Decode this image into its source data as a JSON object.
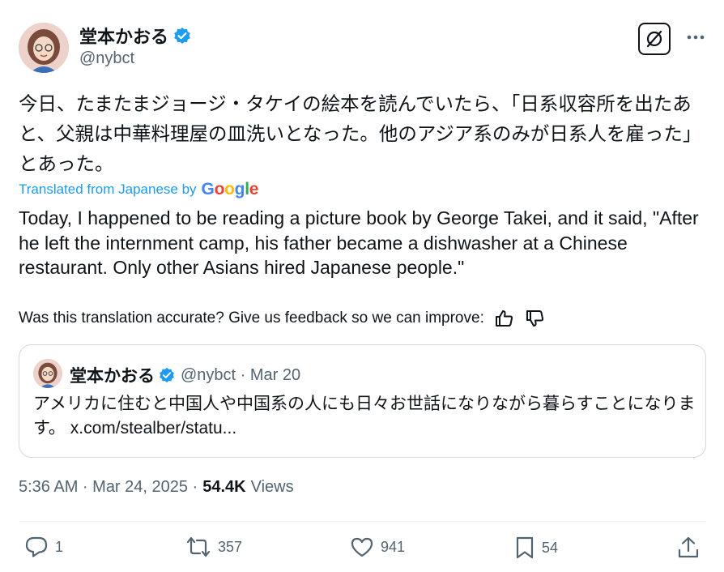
{
  "author": {
    "display_name": "堂本かおる",
    "handle": "@nybct",
    "verified_icon": "verified-badge-icon"
  },
  "tweet": {
    "text_jp": "今日、たまたまジョージ・タケイの絵本を読んでいたら、「日系収容所を出たあと、父親は中華料理屋の皿洗いとなった。他のアジア系のみが日系人を雇った」とあった。",
    "translated_label": "Translated from Japanese by",
    "translation_provider": "Google",
    "text_en": "Today, I happened to be reading a picture book by George Takei, and it said, \"After he left the internment camp, his father became a dishwasher at a Chinese restaurant. Only other Asians hired Japanese people.\"",
    "feedback_prompt": "Was this translation accurate? Give us feedback so we can improve:"
  },
  "quote": {
    "display_name": "堂本かおる",
    "handle_date": "@nybct · Mar 20",
    "text": "アメリカに住むと中国人や中国系の人にも日々お世話になりながら暮らすことになります。",
    "link": "x.com/stealber/statu..."
  },
  "meta": {
    "timestamp": "5:36 AM · Mar 24, 2025 ·",
    "views_count": "54.4K",
    "views_label": "Views"
  },
  "actions": {
    "replies": "1",
    "reposts": "357",
    "likes": "941",
    "bookmarks": "54"
  },
  "colors": {
    "accent": "#1d9bf0",
    "text": "#0f1419",
    "secondary": "#536471",
    "border": "#cfd9de"
  }
}
